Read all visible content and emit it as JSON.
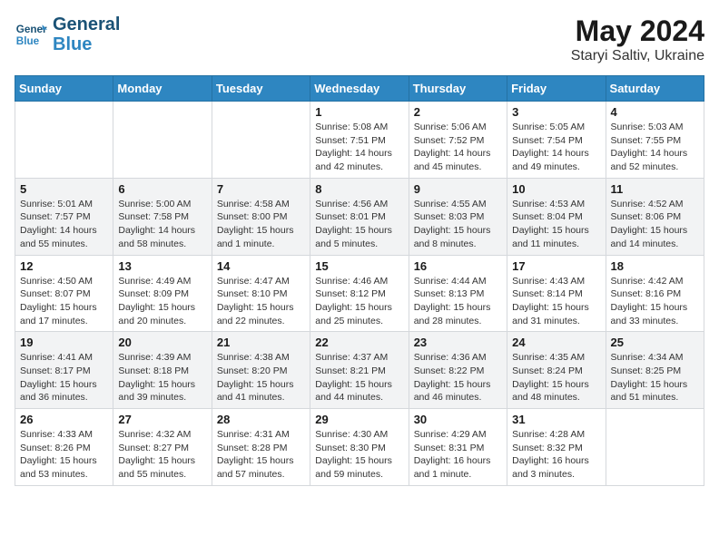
{
  "header": {
    "logo_general": "General",
    "logo_blue": "Blue",
    "month_title": "May 2024",
    "location": "Staryi Saltiv, Ukraine"
  },
  "weekdays": [
    "Sunday",
    "Monday",
    "Tuesday",
    "Wednesday",
    "Thursday",
    "Friday",
    "Saturday"
  ],
  "weeks": [
    [
      null,
      null,
      null,
      {
        "day": "1",
        "sunrise": "5:08 AM",
        "sunset": "7:51 PM",
        "daylight": "14 hours and 42 minutes."
      },
      {
        "day": "2",
        "sunrise": "5:06 AM",
        "sunset": "7:52 PM",
        "daylight": "14 hours and 45 minutes."
      },
      {
        "day": "3",
        "sunrise": "5:05 AM",
        "sunset": "7:54 PM",
        "daylight": "14 hours and 49 minutes."
      },
      {
        "day": "4",
        "sunrise": "5:03 AM",
        "sunset": "7:55 PM",
        "daylight": "14 hours and 52 minutes."
      }
    ],
    [
      {
        "day": "5",
        "sunrise": "5:01 AM",
        "sunset": "7:57 PM",
        "daylight": "14 hours and 55 minutes."
      },
      {
        "day": "6",
        "sunrise": "5:00 AM",
        "sunset": "7:58 PM",
        "daylight": "14 hours and 58 minutes."
      },
      {
        "day": "7",
        "sunrise": "4:58 AM",
        "sunset": "8:00 PM",
        "daylight": "15 hours and 1 minute."
      },
      {
        "day": "8",
        "sunrise": "4:56 AM",
        "sunset": "8:01 PM",
        "daylight": "15 hours and 5 minutes."
      },
      {
        "day": "9",
        "sunrise": "4:55 AM",
        "sunset": "8:03 PM",
        "daylight": "15 hours and 8 minutes."
      },
      {
        "day": "10",
        "sunrise": "4:53 AM",
        "sunset": "8:04 PM",
        "daylight": "15 hours and 11 minutes."
      },
      {
        "day": "11",
        "sunrise": "4:52 AM",
        "sunset": "8:06 PM",
        "daylight": "15 hours and 14 minutes."
      }
    ],
    [
      {
        "day": "12",
        "sunrise": "4:50 AM",
        "sunset": "8:07 PM",
        "daylight": "15 hours and 17 minutes."
      },
      {
        "day": "13",
        "sunrise": "4:49 AM",
        "sunset": "8:09 PM",
        "daylight": "15 hours and 20 minutes."
      },
      {
        "day": "14",
        "sunrise": "4:47 AM",
        "sunset": "8:10 PM",
        "daylight": "15 hours and 22 minutes."
      },
      {
        "day": "15",
        "sunrise": "4:46 AM",
        "sunset": "8:12 PM",
        "daylight": "15 hours and 25 minutes."
      },
      {
        "day": "16",
        "sunrise": "4:44 AM",
        "sunset": "8:13 PM",
        "daylight": "15 hours and 28 minutes."
      },
      {
        "day": "17",
        "sunrise": "4:43 AM",
        "sunset": "8:14 PM",
        "daylight": "15 hours and 31 minutes."
      },
      {
        "day": "18",
        "sunrise": "4:42 AM",
        "sunset": "8:16 PM",
        "daylight": "15 hours and 33 minutes."
      }
    ],
    [
      {
        "day": "19",
        "sunrise": "4:41 AM",
        "sunset": "8:17 PM",
        "daylight": "15 hours and 36 minutes."
      },
      {
        "day": "20",
        "sunrise": "4:39 AM",
        "sunset": "8:18 PM",
        "daylight": "15 hours and 39 minutes."
      },
      {
        "day": "21",
        "sunrise": "4:38 AM",
        "sunset": "8:20 PM",
        "daylight": "15 hours and 41 minutes."
      },
      {
        "day": "22",
        "sunrise": "4:37 AM",
        "sunset": "8:21 PM",
        "daylight": "15 hours and 44 minutes."
      },
      {
        "day": "23",
        "sunrise": "4:36 AM",
        "sunset": "8:22 PM",
        "daylight": "15 hours and 46 minutes."
      },
      {
        "day": "24",
        "sunrise": "4:35 AM",
        "sunset": "8:24 PM",
        "daylight": "15 hours and 48 minutes."
      },
      {
        "day": "25",
        "sunrise": "4:34 AM",
        "sunset": "8:25 PM",
        "daylight": "15 hours and 51 minutes."
      }
    ],
    [
      {
        "day": "26",
        "sunrise": "4:33 AM",
        "sunset": "8:26 PM",
        "daylight": "15 hours and 53 minutes."
      },
      {
        "day": "27",
        "sunrise": "4:32 AM",
        "sunset": "8:27 PM",
        "daylight": "15 hours and 55 minutes."
      },
      {
        "day": "28",
        "sunrise": "4:31 AM",
        "sunset": "8:28 PM",
        "daylight": "15 hours and 57 minutes."
      },
      {
        "day": "29",
        "sunrise": "4:30 AM",
        "sunset": "8:30 PM",
        "daylight": "15 hours and 59 minutes."
      },
      {
        "day": "30",
        "sunrise": "4:29 AM",
        "sunset": "8:31 PM",
        "daylight": "16 hours and 1 minute."
      },
      {
        "day": "31",
        "sunrise": "4:28 AM",
        "sunset": "8:32 PM",
        "daylight": "16 hours and 3 minutes."
      },
      null
    ]
  ],
  "labels": {
    "sunrise_prefix": "Sunrise: ",
    "sunset_prefix": "Sunset: ",
    "daylight_prefix": "Daylight: "
  }
}
